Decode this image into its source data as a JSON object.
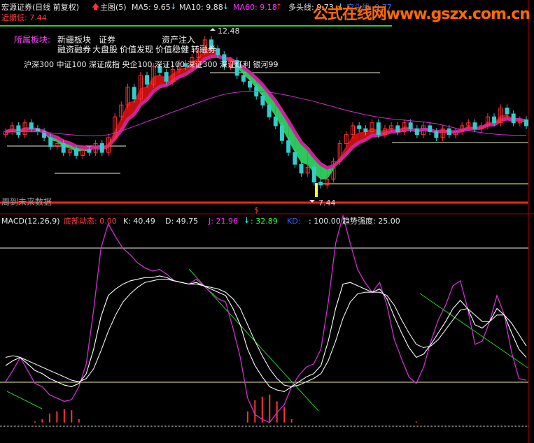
{
  "header": {
    "stock": "宏源证券(日线 前复权)",
    "main_label": "主图(5)",
    "ma5_label": "MA5: 9.65",
    "ma10_label": "MA10: 9.88",
    "ma60_label": "MA60: 9.18",
    "bull_label": "多头线: 9.73",
    "bear_label": "空头线: 9.77",
    "recent_low": "近期低: 7.44",
    "watermark": "公式在线网www.gszx.com.cn"
  },
  "plates": {
    "title": "所属板块:",
    "row1": [
      "新疆板块",
      "证券",
      "资产注入"
    ],
    "row2": [
      "融资融券",
      "大盘股",
      "价值发现",
      "价值稳健",
      "转融券"
    ],
    "row3": "沪深300 中证100 深证成指 央企100 深证100 深证300 深证红利 银河99"
  },
  "labels": {
    "high_price": "12.48",
    "low_price": "7.44",
    "future_text": "周到未来数据",
    "dollar": "$"
  },
  "sub_header": {
    "macd": "MACD(12,26,9)",
    "bottom_label": "底部动态: 0.00",
    "k_label": "K: 40.49",
    "d_label": "D: 49.75",
    "j_label": "J: 21.96",
    "v4_label": ": 32.89",
    "v5_label": "KD: ",
    "v6_label": ": 100.00",
    "trend_label": "趋势强度: 25.00"
  },
  "colors": {
    "bg": "#000000",
    "up": "#ff3333",
    "down": "#33cccc",
    "ma_white": "#f0f0f0",
    "ma_pink": "#cc33cc",
    "band_red": "#dd1111",
    "band_green": "#33dd66",
    "band_pink": "#cc2299",
    "k_line": "#ffffff",
    "d_line": "#f0f0f0",
    "j_line": "#cc33cc",
    "trend_line": "#22cc22",
    "yellow": "#ffff66"
  },
  "chart_data": {
    "type": "line",
    "price_axis": {
      "ylim": [
        7.0,
        12.8
      ]
    },
    "price_series": {
      "name": "close",
      "values": [
        9.3,
        9.5,
        9.2,
        9.6,
        9.4,
        9.3,
        9.1,
        8.8,
        8.9,
        8.6,
        8.7,
        8.5,
        8.7,
        8.6,
        8.9,
        8.6,
        9.1,
        9.8,
        10.2,
        10.8,
        10.4,
        11.2,
        10.9,
        11.5,
        11.3,
        11.0,
        11.4,
        11.6,
        11.5,
        11.8,
        12.0,
        12.4,
        12.1,
        11.9,
        11.5,
        11.7,
        11.2,
        11.0,
        10.8,
        10.5,
        10.2,
        9.8,
        9.5,
        9.0,
        8.6,
        8.2,
        7.9,
        8.1,
        7.6,
        7.5,
        7.7,
        8.3,
        8.9,
        9.2,
        9.5,
        9.4,
        9.3,
        9.6,
        9.2,
        9.4,
        9.5,
        9.3,
        9.6,
        9.4,
        9.2,
        9.5,
        9.3,
        9.1,
        9.4,
        9.2,
        9.3,
        9.5,
        9.6,
        9.4,
        9.5,
        9.8,
        9.6,
        10.1,
        9.9,
        9.6,
        9.7,
        9.5
      ]
    },
    "ma60": {
      "values": [
        9.3,
        9.3,
        9.3,
        9.3,
        9.3,
        9.3,
        9.28,
        9.26,
        9.24,
        9.22,
        9.2,
        9.18,
        9.17,
        9.16,
        9.16,
        9.17,
        9.2,
        9.25,
        9.32,
        9.4,
        9.48,
        9.56,
        9.64,
        9.72,
        9.8,
        9.88,
        9.96,
        10.04,
        10.12,
        10.2,
        10.28,
        10.36,
        10.43,
        10.5,
        10.56,
        10.6,
        10.63,
        10.65,
        10.66,
        10.66,
        10.65,
        10.63,
        10.6,
        10.56,
        10.52,
        10.47,
        10.42,
        10.37,
        10.32,
        10.26,
        10.2,
        10.14,
        10.08,
        10.02,
        9.97,
        9.92,
        9.87,
        9.83,
        9.79,
        9.76,
        9.73,
        9.71,
        9.69,
        9.67,
        9.65,
        9.63,
        9.6,
        9.57,
        9.52,
        9.47,
        9.42,
        9.38,
        9.34,
        9.3,
        9.27,
        9.24,
        9.22,
        9.2,
        9.19,
        9.18,
        9.18,
        9.18
      ]
    },
    "kdj_axis": {
      "ylim": [
        -10,
        120
      ]
    },
    "k_series": {
      "name": "K",
      "values": [
        35,
        38,
        40,
        36,
        32,
        30,
        27,
        25,
        23,
        22,
        24,
        30,
        45,
        65,
        78,
        82,
        85,
        87,
        88,
        89,
        89,
        90,
        89,
        87,
        86,
        85,
        86,
        84,
        82,
        80,
        78,
        70,
        60,
        45,
        35,
        28,
        22,
        20,
        19,
        22,
        25,
        28,
        30,
        35,
        50,
        70,
        85,
        86,
        84,
        82,
        80,
        82,
        76,
        65,
        55,
        46,
        40,
        42,
        48,
        55,
        62,
        70,
        75,
        70,
        60,
        58,
        62,
        70,
        66,
        55,
        45,
        40
      ]
    },
    "d_series": {
      "name": "D",
      "values": [
        40,
        41,
        40,
        38,
        36,
        34,
        32,
        30,
        28,
        26,
        25,
        27,
        33,
        44,
        56,
        66,
        74,
        79,
        83,
        86,
        87,
        88,
        88,
        87,
        86,
        85,
        85,
        84,
        83,
        82,
        80,
        76,
        70,
        60,
        50,
        41,
        33,
        27,
        23,
        22,
        23,
        25,
        27,
        30,
        38,
        50,
        64,
        74,
        79,
        80,
        80,
        80,
        78,
        72,
        63,
        55,
        48,
        46,
        47,
        51,
        57,
        63,
        69,
        70,
        66,
        62,
        62,
        66,
        66,
        61,
        54,
        47
      ]
    },
    "j_series": {
      "name": "J",
      "values": [
        25,
        32,
        40,
        32,
        24,
        22,
        17,
        15,
        13,
        14,
        22,
        36,
        69,
        107,
        122,
        114,
        107,
        103,
        98,
        95,
        93,
        94,
        91,
        87,
        86,
        85,
        88,
        84,
        80,
        76,
        74,
        58,
        40,
        15,
        5,
        2,
        0,
        6,
        11,
        22,
        29,
        34,
        36,
        45,
        74,
        110,
        127,
        110,
        94,
        86,
        80,
        86,
        72,
        51,
        39,
        28,
        24,
        34,
        50,
        63,
        72,
        84,
        87,
        70,
        48,
        50,
        62,
        78,
        66,
        43,
        27,
        26
      ]
    }
  }
}
